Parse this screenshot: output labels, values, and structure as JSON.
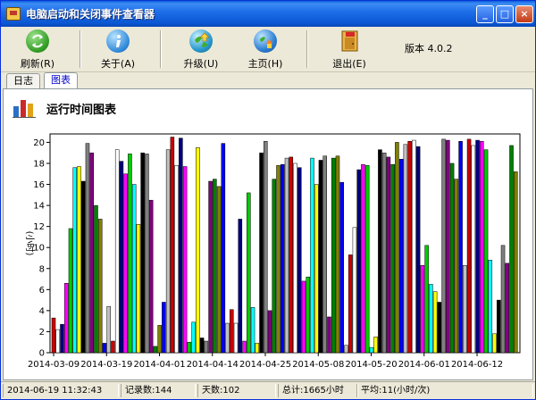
{
  "window": {
    "title": "电脑启动和关闭事件查看器",
    "controls": {
      "minimize": "_",
      "maximize": "□",
      "close": "×"
    }
  },
  "toolbar": {
    "refresh_label": "刷新(R)",
    "about_label": "关于(A)",
    "upgrade_label": "升级(U)",
    "home_label": "主页(H)",
    "exit_label": "退出(E)",
    "version_label": "版本 4.0.2"
  },
  "tabs": [
    {
      "label": "日志",
      "active": false
    },
    {
      "label": "图表",
      "active": true
    }
  ],
  "panel": {
    "title": "运行时间图表"
  },
  "colors": {
    "palette": [
      "#cc0000",
      "#ffffff",
      "#000080",
      "#ff00ff",
      "#00cc00",
      "#00ffff",
      "#ffff00",
      "#000000",
      "#808080",
      "#800080",
      "#008000",
      "#808000",
      "#0000ff",
      "#c0c0c0"
    ]
  },
  "chart_data": {
    "type": "bar",
    "title": "",
    "xlabel": "",
    "ylabel": "(小时)",
    "ylim": [
      0,
      20.8
    ],
    "yticks": [
      "0",
      "2",
      "4",
      "6",
      "8",
      "10",
      "12",
      "14",
      "16",
      "18",
      "20"
    ],
    "xticks": [
      "2014-03-09",
      "2014-03-19",
      "2014-04-01",
      "2014-04-14",
      "2014-04-25",
      "2014-05-08",
      "2014-05-20",
      "2014-06-01",
      "2014-06-12"
    ],
    "grid": false,
    "legend": "none",
    "color_rule": "palette cycle by bar index",
    "values": [
      3.3,
      2.2,
      2.7,
      6.6,
      11.8,
      17.6,
      17.7,
      16.3,
      19.9,
      19.0,
      14.0,
      12.7,
      0.9,
      4.4,
      1.1,
      19.3,
      18.2,
      17.0,
      18.9,
      16.0,
      12.2,
      19.0,
      18.9,
      14.5,
      0.6,
      2.6,
      4.8,
      19.3,
      20.5,
      17.8,
      20.4,
      17.7,
      1.0,
      2.9,
      19.5,
      1.4,
      1.1,
      16.3,
      16.5,
      15.8,
      19.9,
      2.8,
      4.1,
      2.8,
      12.7,
      1.1,
      15.2,
      4.3,
      0.9,
      19.0,
      20.1,
      4.0,
      16.5,
      17.8,
      17.9,
      18.5,
      18.6,
      18.0,
      17.6,
      6.8,
      7.2,
      18.5,
      16.0,
      18.3,
      18.7,
      3.4,
      18.5,
      18.7,
      16.2,
      0.7,
      9.3,
      11.9,
      17.4,
      17.9,
      17.8,
      0.5,
      1.5,
      19.3,
      19.0,
      18.6,
      17.9,
      20.0,
      18.4,
      19.8,
      20.1,
      20.2,
      19.6,
      8.3,
      10.2,
      6.5,
      5.8,
      4.8,
      20.3,
      20.2,
      18.0,
      16.5,
      20.1,
      8.3,
      20.3,
      19.7,
      20.2,
      20.1,
      19.3,
      8.8,
      1.8,
      5.0,
      10.2,
      8.5,
      19.7,
      17.2
    ]
  },
  "statusbar": {
    "datetime": "2014-06-19 11:32:43",
    "records": "记录数:144",
    "days": "天数:102",
    "total": "总计:1665小时",
    "average": "平均:11(小时/次)"
  }
}
